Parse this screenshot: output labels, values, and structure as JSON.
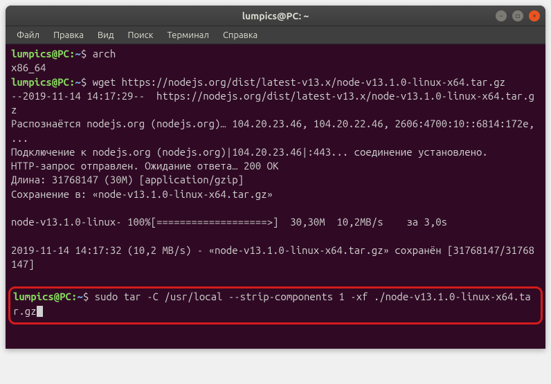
{
  "window": {
    "title": "lumpics@PC: ~"
  },
  "menubar": {
    "items": [
      "Файл",
      "Правка",
      "Вид",
      "Поиск",
      "Терминал",
      "Справка"
    ]
  },
  "prompt": {
    "user_host": "lumpics@PC:",
    "path": "~",
    "symbol": "$"
  },
  "lines": {
    "cmd1": "arch",
    "out1": "x86_64",
    "cmd2": "wget https://nodejs.org/dist/latest-v13.x/node-v13.1.0-linux-x64.tar.gz",
    "out2a": "--2019-11-14 14:17:29--  https://nodejs.org/dist/latest-v13.x/node-v13.1.0-linux-x64.tar.gz",
    "out2b": "Распознаётся nodejs.org (nodejs.org)… 104.20.23.46, 104.20.22.46, 2606:4700:10::6814:172e, ...",
    "out2c": "Подключение к nodejs.org (nodejs.org)|104.20.23.46|:443... соединение установлено.",
    "out2d": "HTTP-запрос отправлен. Ожидание ответа… 200 OK",
    "out2e": "Длина: 31768147 (30M) [application/gzip]",
    "out2f": "Сохранение в: «node-v13.1.0-linux-x64.tar.gz»",
    "out2g": "node-v13.1.0-linux- 100%[===================>]  30,30M  10,2MB/s    за 3,0s",
    "out2h": "2019-11-14 14:17:32 (10,2 MB/s) - «node-v13.1.0-linux-x64.tar.gz» сохранён [31768147/31768147]",
    "cmd3": "sudo tar -C /usr/local --strip-components 1 -xf ./node-v13.1.0-linux-x64.tar.gz"
  }
}
